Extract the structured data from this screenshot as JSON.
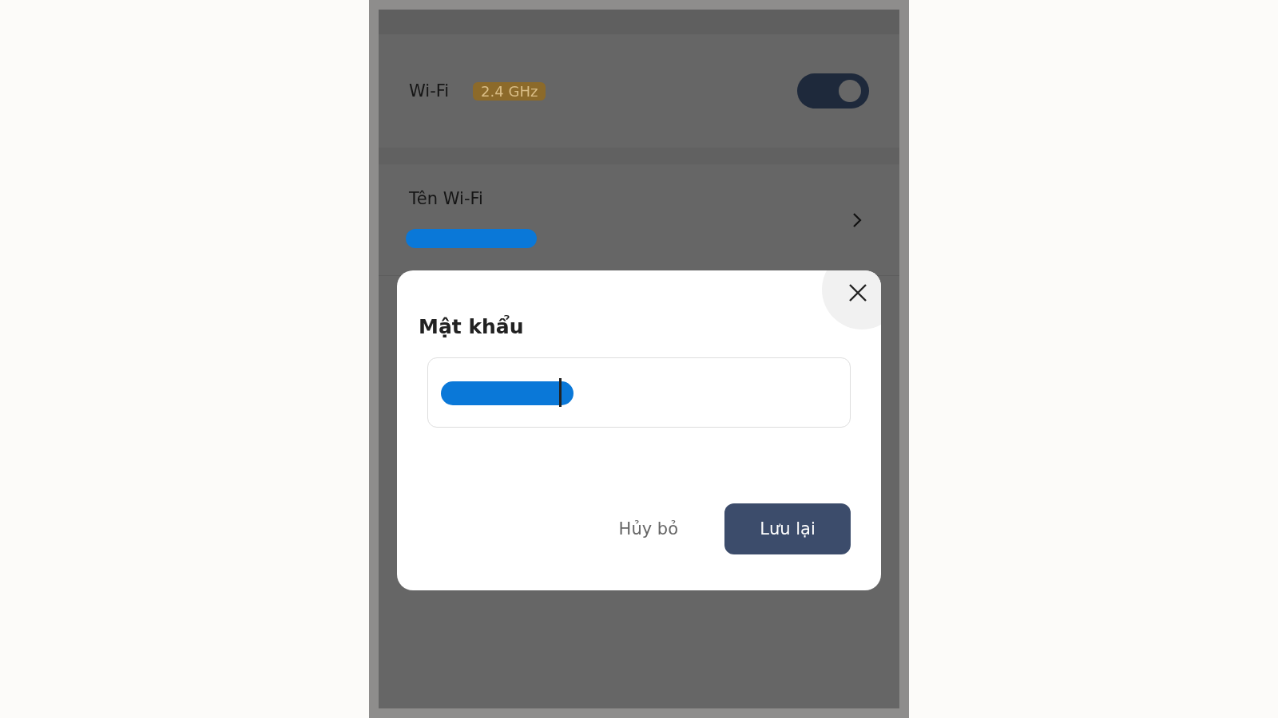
{
  "wifi_row": {
    "label": "Wi-Fi",
    "band_badge": "2.4 GHz",
    "on": true
  },
  "name_row": {
    "label": "Tên Wi-Fi"
  },
  "dialog": {
    "title": "Mật khẩu",
    "buttons": [
      {
        "kind": "text",
        "label": "Hủy bỏ"
      },
      {
        "kind": "primary",
        "label": "Lưu lại"
      }
    ]
  }
}
